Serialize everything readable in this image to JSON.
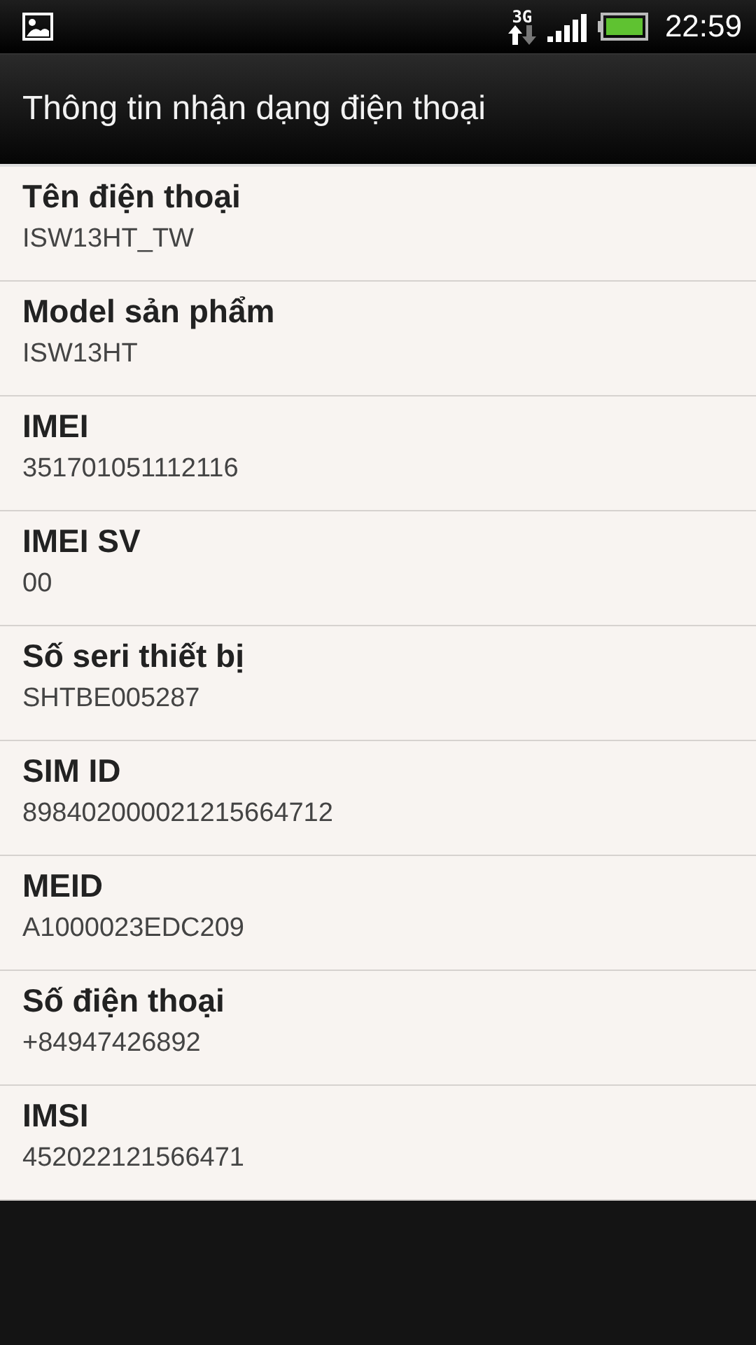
{
  "status_bar": {
    "time": "22:59",
    "network": "3G"
  },
  "title_bar": {
    "title": "Thông tin nhận dạng điện thoại"
  },
  "items": [
    {
      "label": "Tên điện thoại",
      "value": "ISW13HT_TW"
    },
    {
      "label": "Model sản phẩm",
      "value": "ISW13HT"
    },
    {
      "label": "IMEI",
      "value": "351701051112116"
    },
    {
      "label": "IMEI SV",
      "value": "00"
    },
    {
      "label": "Số seri thiết bị",
      "value": "SHTBE005287"
    },
    {
      "label": "SIM ID",
      "value": "898402000021215664712"
    },
    {
      "label": "MEID",
      "value": "A1000023EDC209"
    },
    {
      "label": "Số điện thoại",
      "value": "+84947426892"
    },
    {
      "label": "IMSI",
      "value": "452022121566471"
    }
  ]
}
